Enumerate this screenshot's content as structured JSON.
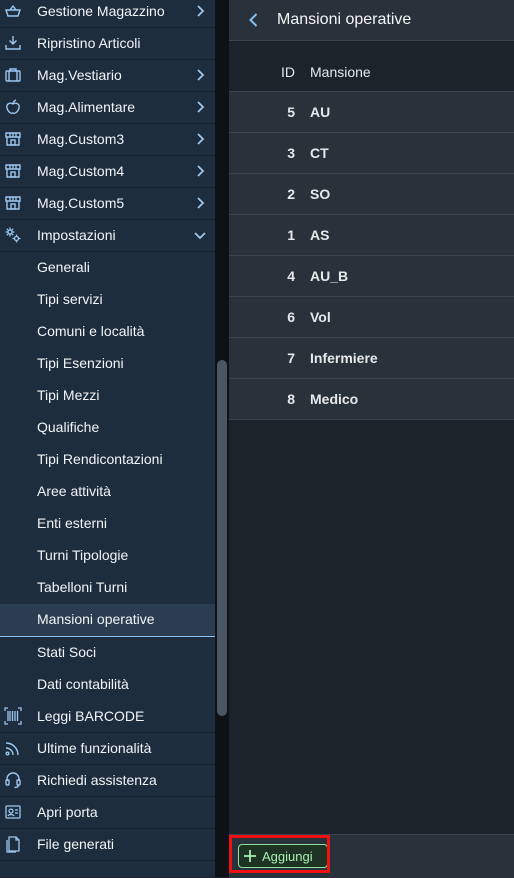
{
  "sidebar": {
    "items": [
      {
        "label": "Gestione Magazzino",
        "icon": "basket-icon"
      },
      {
        "label": "Ripristino Articoli",
        "icon": "download-tray-icon"
      },
      {
        "label": "Mag.Vestiario",
        "icon": "suitcase-icon"
      },
      {
        "label": "Mag.Alimentare",
        "icon": "apple-icon"
      },
      {
        "label": "Mag.Custom3",
        "icon": "store-icon"
      },
      {
        "label": "Mag.Custom4",
        "icon": "store-icon"
      },
      {
        "label": "Mag.Custom5",
        "icon": "store-icon"
      },
      {
        "label": "Impostazioni",
        "icon": "settings-icon"
      }
    ],
    "sub_items": [
      "Generali",
      "Tipi servizi",
      "Comuni e località",
      "Tipi Esenzioni",
      "Tipi Mezzi",
      "Qualifiche",
      "Tipi Rendicontazioni",
      "Aree attività",
      "Enti esterni",
      "Turni Tipologie",
      "Tabelloni Turni",
      "Mansioni operative",
      "Stati Soci",
      "Dati contabilità"
    ],
    "selected_sub_item": "Mansioni operative",
    "bottom_items": [
      {
        "label": "Leggi BARCODE",
        "icon": "barcode-icon"
      },
      {
        "label": "Ultime funzionalità",
        "icon": "feed-icon"
      },
      {
        "label": "Richiedi assistenza",
        "icon": "headset-icon"
      },
      {
        "label": "Apri porta",
        "icon": "badge-icon"
      },
      {
        "label": "File generati",
        "icon": "documents-icon"
      }
    ]
  },
  "header": {
    "title": "Mansioni operative"
  },
  "table": {
    "columns": [
      "ID",
      "Mansione"
    ],
    "rows": [
      {
        "id": "5",
        "name": "AU"
      },
      {
        "id": "3",
        "name": "CT"
      },
      {
        "id": "2",
        "name": "SO"
      },
      {
        "id": "1",
        "name": "AS"
      },
      {
        "id": "4",
        "name": "AU_B"
      },
      {
        "id": "6",
        "name": "Vol"
      },
      {
        "id": "7",
        "name": "Infermiere"
      },
      {
        "id": "8",
        "name": "Medico"
      }
    ]
  },
  "footer": {
    "add_label": "Aggiungi"
  },
  "colors": {
    "sidebar_bg": "#1d2d3e",
    "accent": "#8bc3f5",
    "add_button": "#8fe09d",
    "highlight": "#ee1111"
  }
}
